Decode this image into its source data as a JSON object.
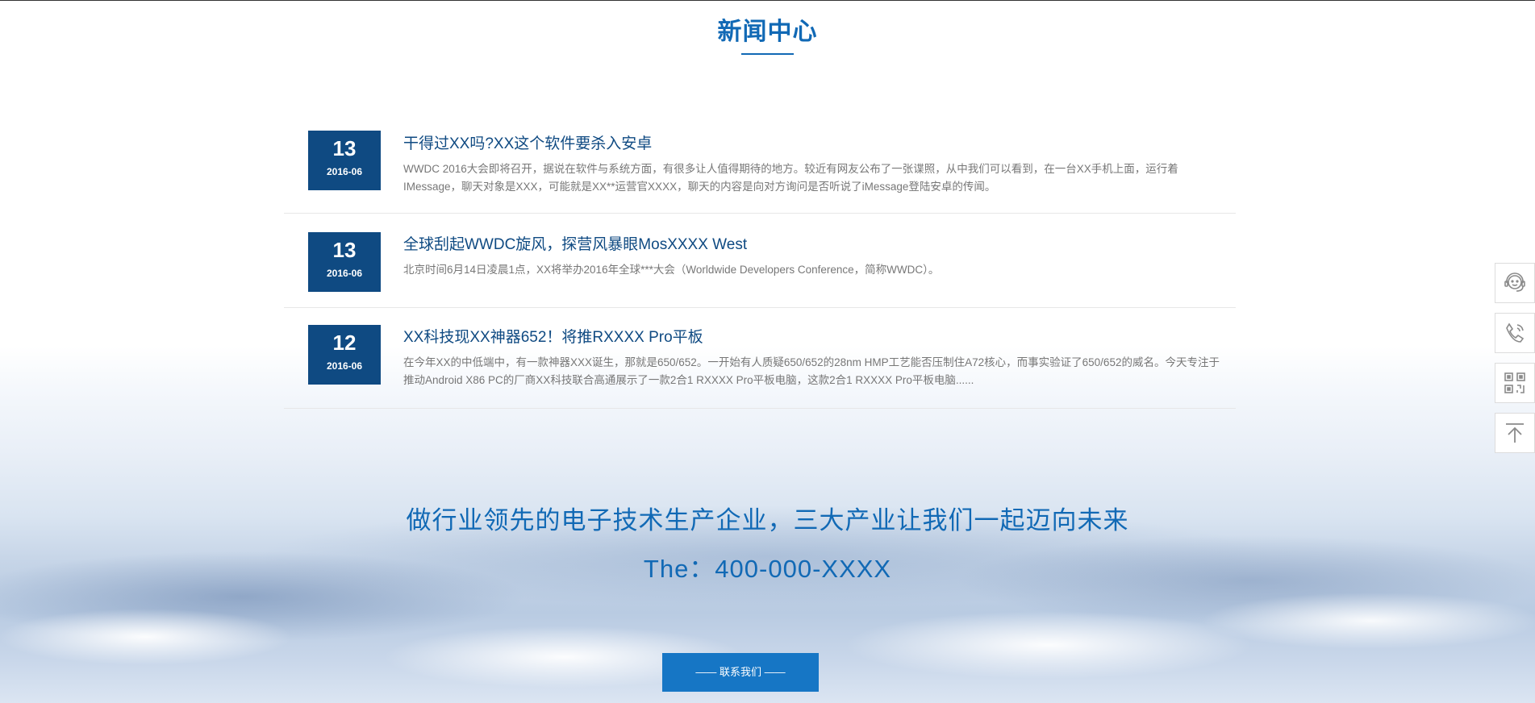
{
  "section": {
    "title": "新闻中心"
  },
  "news": [
    {
      "day": "13",
      "ym": "2016-06",
      "title": "干得过XX吗?XX这个软件要杀入安卓",
      "desc": "WWDC 2016大会即将召开，据说在软件与系统方面，有很多让人值得期待的地方。较近有网友公布了一张谍照，从中我们可以看到，在一台XX手机上面，运行着IMessage，聊天对象是XXX，可能就是XX**运营官XXXX，聊天的内容是向对方询问是否听说了iMessage登陆安卓的传闻。"
    },
    {
      "day": "13",
      "ym": "2016-06",
      "title": "全球刮起WWDC旋风，探营风暴眼MosXXXX West",
      "desc": "北京时间6月14日凌晨1点，XX将举办2016年全球***大会（Worldwide Developers Conference，简称WWDC）。"
    },
    {
      "day": "12",
      "ym": "2016-06",
      "title": "XX科技现XX神器652！将推RXXXX Pro平板",
      "desc": "在今年XX的中低端中，有一款神器XXX诞生，那就是650/652。一开始有人质疑650/652的28nm HMP工艺能否压制住A72核心，而事实验证了650/652的威名。今天专注于推动Android X86 PC的厂商XX科技联合高通展示了一款2合1 RXXXX Pro平板电脑，这款2合1 RXXXX Pro平板电脑......"
    }
  ],
  "banner": {
    "slogan": "做行业领先的电子技术生产企业，三大产业让我们一起迈向未来",
    "phone": "The：400-000-XXXX",
    "button": "—— 联系我们 ——"
  },
  "side_icons": [
    "customer-service-icon",
    "phone-icon",
    "qrcode-icon",
    "back-to-top-icon"
  ],
  "colors": {
    "accent": "#1169b5",
    "date_bg": "#0f4a82",
    "button_bg": "#1676c5"
  }
}
